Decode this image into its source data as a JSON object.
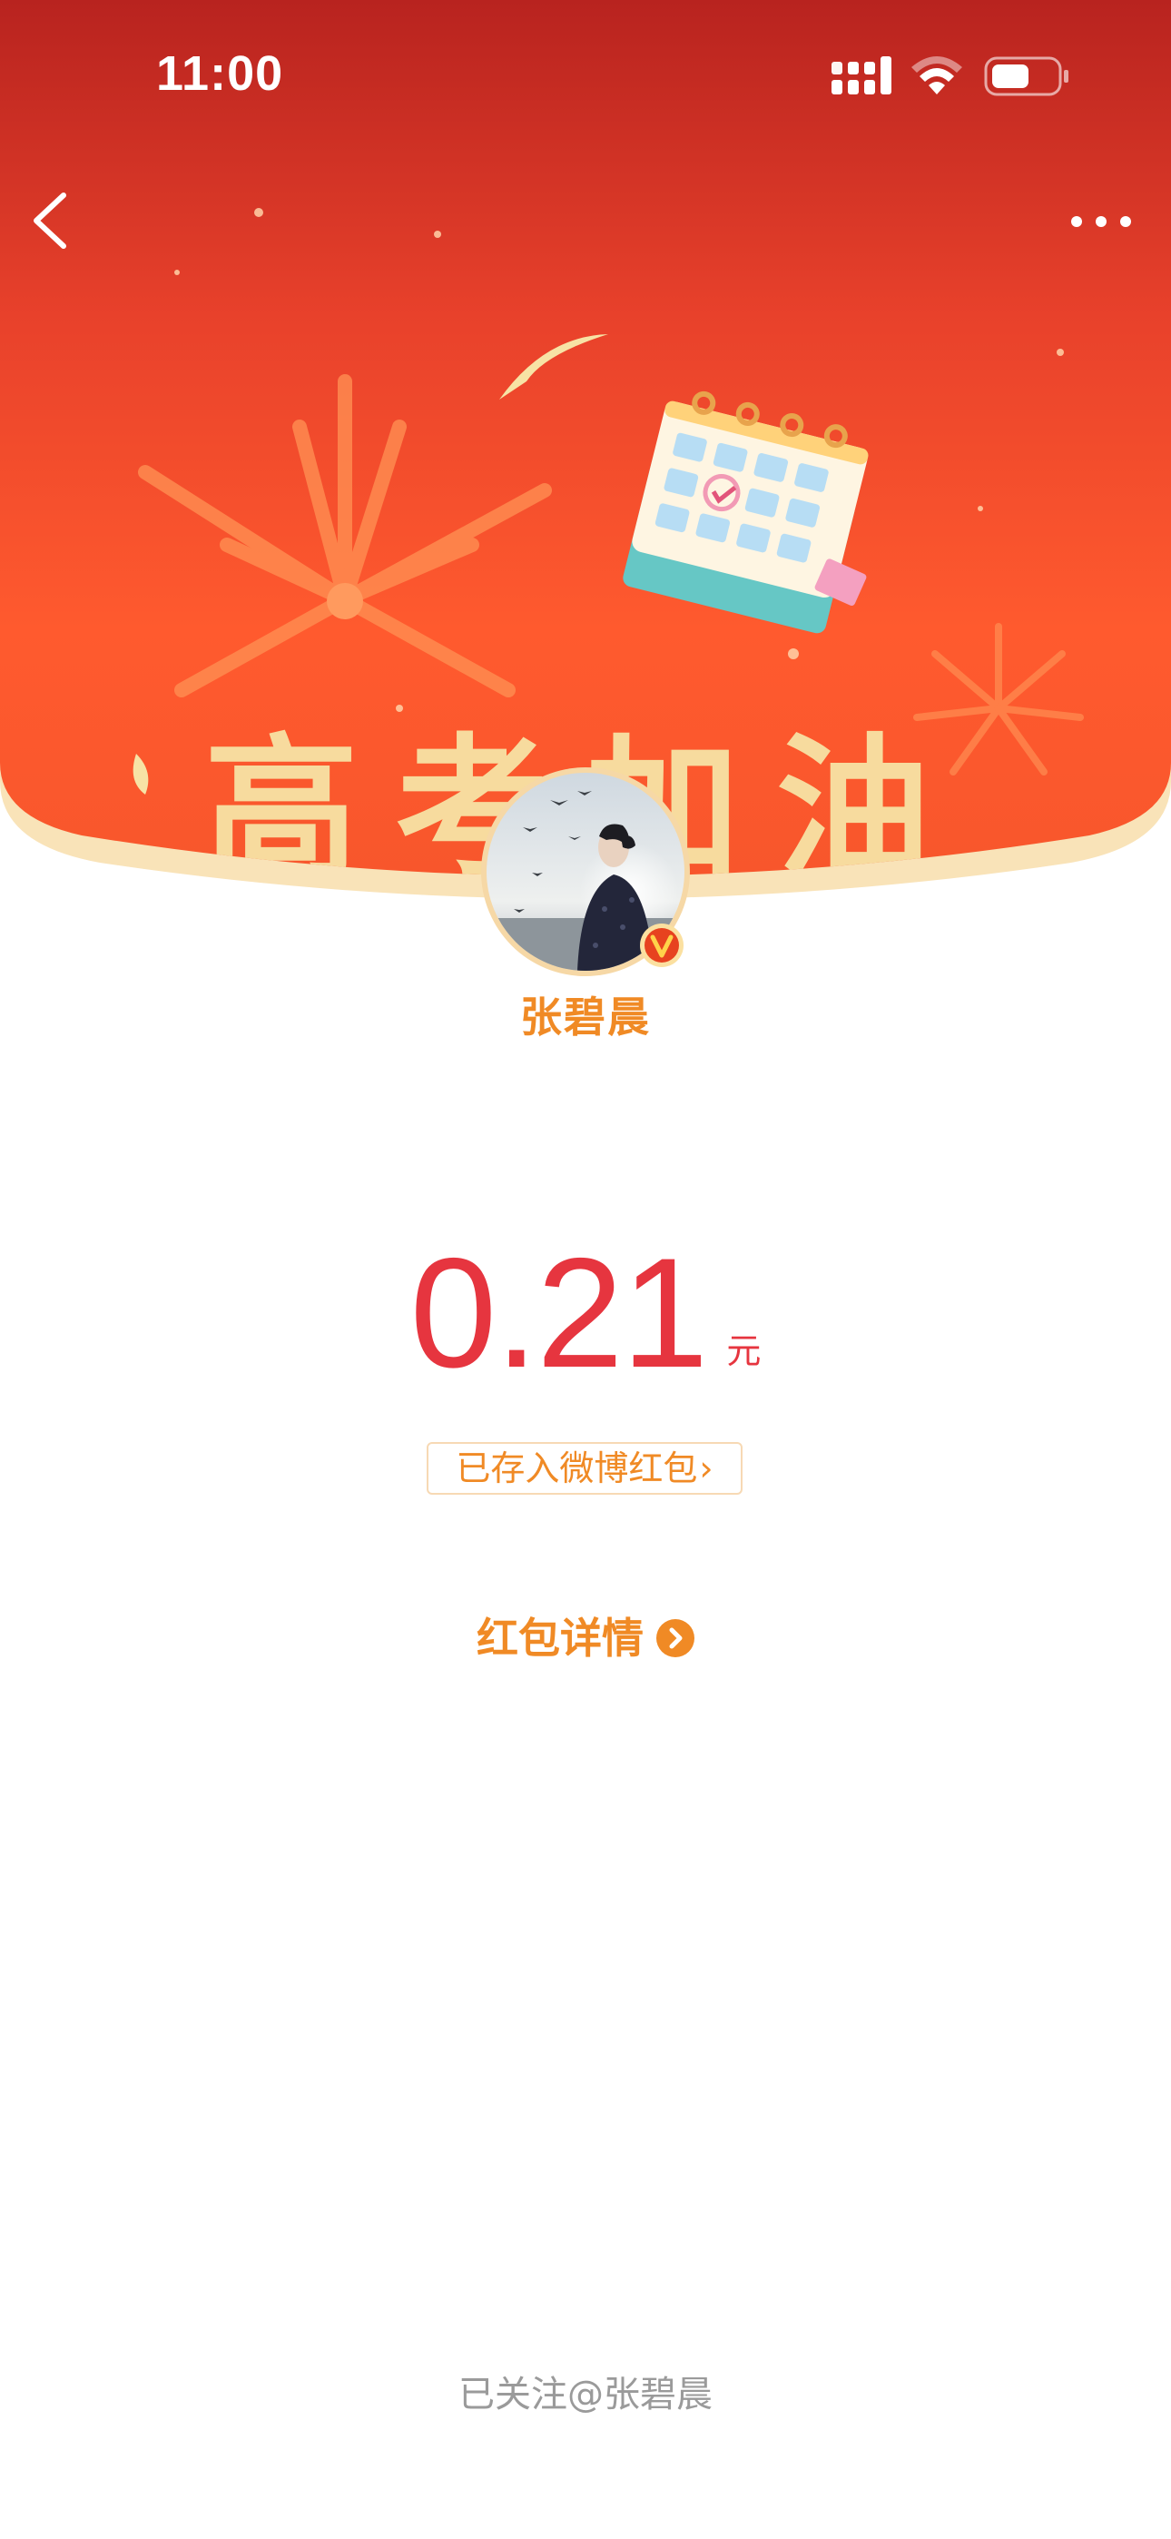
{
  "status_bar": {
    "time": "11:00"
  },
  "banner": {
    "slogan": "高考加油",
    "theme_colors": [
      "#b8231f",
      "#ff5a2e",
      "#f7e3a5"
    ]
  },
  "icons": {
    "back": "chevron-left-icon",
    "more": "ellipsis-icon",
    "verified": "verified-v-badge-icon",
    "details": "chevron-right-circle-icon"
  },
  "sender": {
    "name": "张碧晨"
  },
  "red_packet": {
    "amount": "0.21",
    "unit": "元",
    "saved_label": "已存入微博红包",
    "details_label": "红包详情"
  },
  "footer": {
    "follow_note": "已关注@张碧晨"
  },
  "colors": {
    "amount": "#e6353f",
    "accent_orange": "#f08a25",
    "muted_text": "#9a9a9a"
  }
}
